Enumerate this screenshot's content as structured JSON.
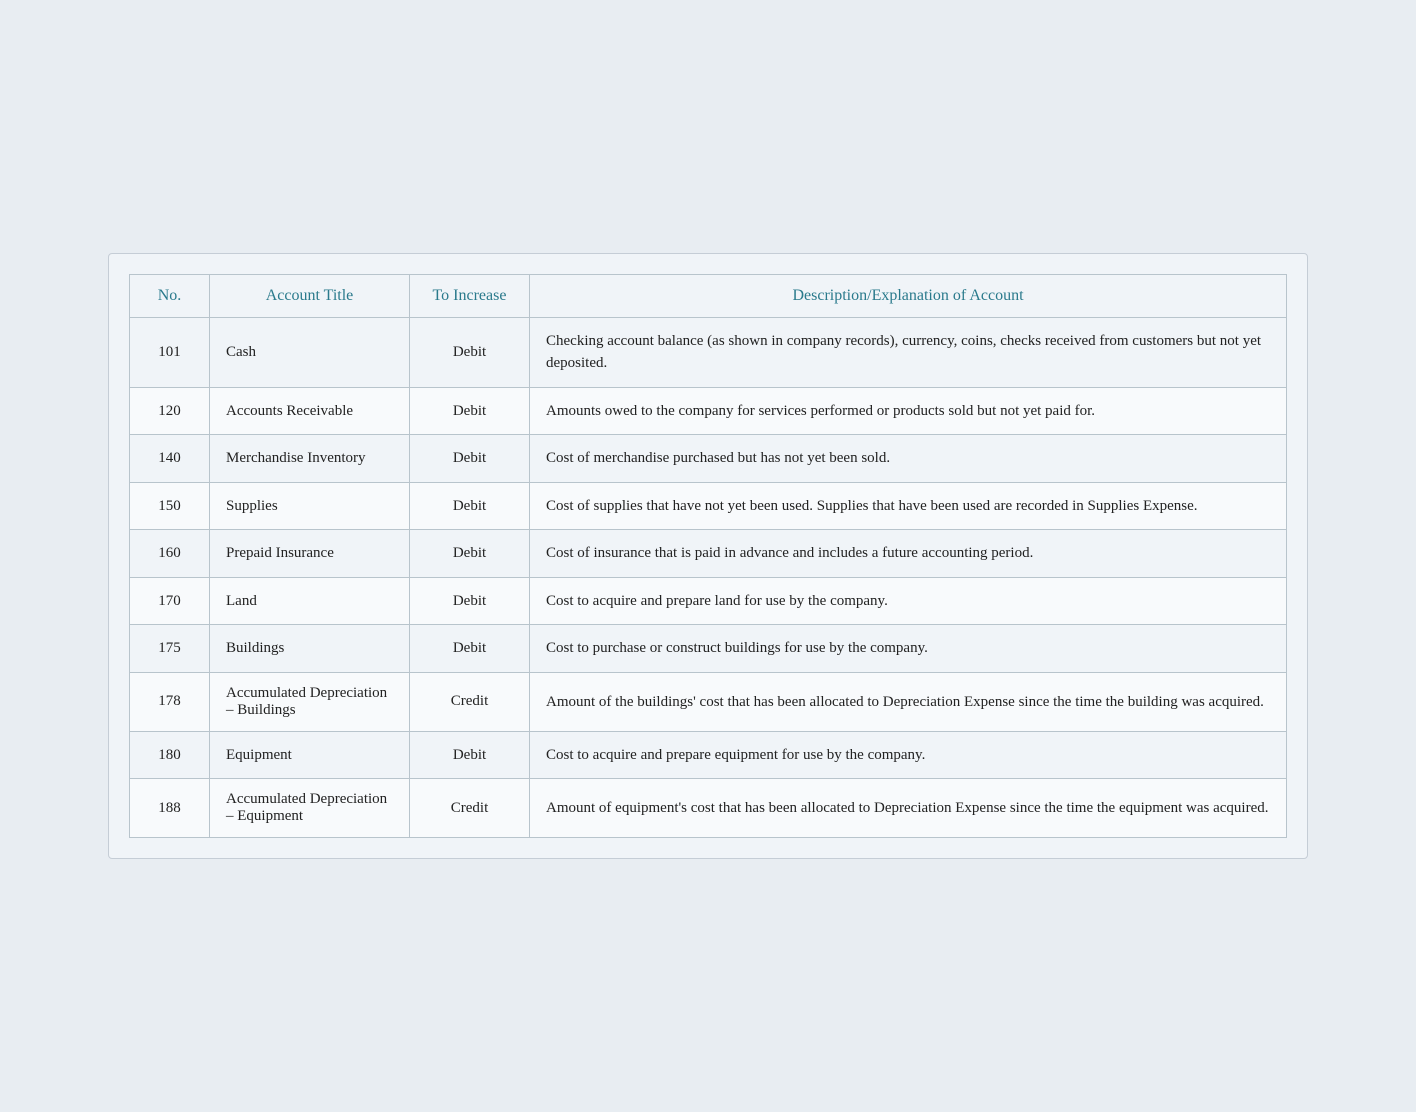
{
  "table": {
    "headers": {
      "no": "No.",
      "account_title": "Account Title",
      "to_increase": "To Increase",
      "description": "Description/Explanation of Account"
    },
    "rows": [
      {
        "no": "101",
        "account_title": "Cash",
        "to_increase": "Debit",
        "description": "Checking account balance (as shown in company records), currency, coins, checks received from customers but not yet deposited."
      },
      {
        "no": "120",
        "account_title": "Accounts Receivable",
        "to_increase": "Debit",
        "description": "Amounts owed to the company for services performed or products sold but not yet paid for."
      },
      {
        "no": "140",
        "account_title": "Merchandise Inventory",
        "to_increase": "Debit",
        "description": "Cost of merchandise purchased but has not yet been sold."
      },
      {
        "no": "150",
        "account_title": "Supplies",
        "to_increase": "Debit",
        "description": "Cost of supplies that have not yet been used. Supplies that have been used are recorded in Supplies Expense."
      },
      {
        "no": "160",
        "account_title": "Prepaid Insurance",
        "to_increase": "Debit",
        "description": "Cost of insurance that is paid in advance and includes a future accounting period."
      },
      {
        "no": "170",
        "account_title": "Land",
        "to_increase": "Debit",
        "description": "Cost to acquire and prepare land for use by the company."
      },
      {
        "no": "175",
        "account_title": "Buildings",
        "to_increase": "Debit",
        "description": "Cost to purchase or construct buildings for use by the company."
      },
      {
        "no": "178",
        "account_title": "Accumulated Depreciation – Buildings",
        "to_increase": "Credit",
        "description": "Amount of the buildings' cost that has been allocated to Depreciation Expense since the time the building was acquired."
      },
      {
        "no": "180",
        "account_title": "Equipment",
        "to_increase": "Debit",
        "description": "Cost to acquire and prepare equipment for use by the company."
      },
      {
        "no": "188",
        "account_title": "Accumulated Depreciation – Equipment",
        "to_increase": "Credit",
        "description": "Amount of equipment's cost that has been allocated to Depreciation Expense since the time the equipment was acquired."
      }
    ]
  }
}
